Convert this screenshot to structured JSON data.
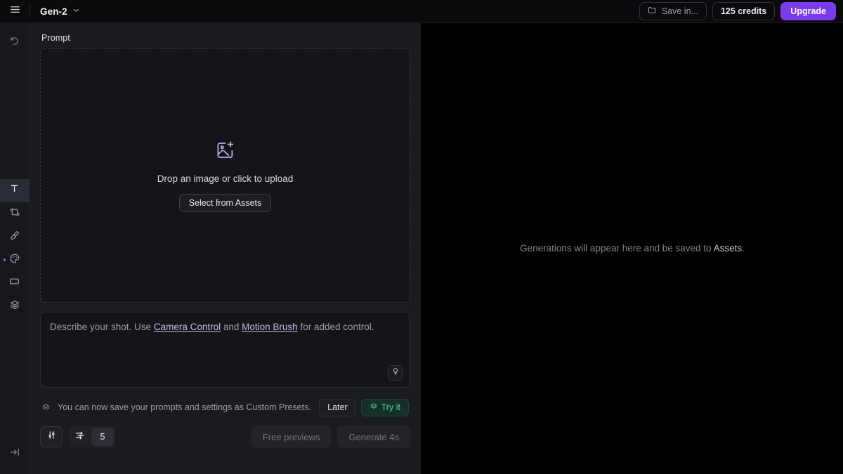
{
  "topbar": {
    "menu_icon": "hamburger-icon",
    "model_name": "Gen-2",
    "model_caret_icon": "chevron-down-icon",
    "save_in_label": "Save in...",
    "save_in_icon": "folder-icon",
    "credits_label": "125 credits",
    "upgrade_label": "Upgrade",
    "upgrade_color": "#7c3aed"
  },
  "rail": {
    "history_icon": "history-undo-icon",
    "tools": [
      {
        "name": "tool-text",
        "icon": "text-T-icon",
        "active": true
      },
      {
        "name": "tool-image-to-video",
        "icon": "image-rotate-icon",
        "active": false
      },
      {
        "name": "tool-motion-brush",
        "icon": "paint-brush-icon",
        "active": false
      },
      {
        "name": "tool-style",
        "icon": "color-palette-icon",
        "active": false,
        "badge": true
      },
      {
        "name": "tool-aspect-ratio",
        "icon": "rectangle-icon",
        "active": false
      },
      {
        "name": "tool-presets",
        "icon": "layers-icon",
        "active": false
      }
    ],
    "expand_icon": "arrow-to-line-right-icon"
  },
  "left": {
    "prompt_label": "Prompt",
    "dropzone": {
      "icon": "image-plus-icon",
      "icon_color": "#b9aee8",
      "text": "Drop an image or click to upload",
      "button_label": "Select from Assets"
    },
    "prompt_input": {
      "value": "",
      "placeholder_part1": "Describe your shot. Use ",
      "link1": "Camera Control",
      "placeholder_part2": " and ",
      "link2": "Motion Brush",
      "placeholder_part3": " for added control.",
      "hint_icon": "lightbulb-icon"
    },
    "notice": {
      "icon": "layers-icon",
      "text": "You can now save your prompts and settings as Custom Presets.",
      "later_label": "Later",
      "try_label": "Try it",
      "try_icon": "layers-icon",
      "try_color": "#4fd6a0"
    },
    "bottom": {
      "settings_icon": "sliders-settings-icon",
      "motion_icon": "motion-speed-icon",
      "motion_value": "5",
      "free_previews_label": "Free previews",
      "generate_label": "Generate 4s"
    }
  },
  "right": {
    "empty_text_part1": "Generations will appear here and be saved to ",
    "empty_link": "Assets",
    "empty_text_part2": "."
  }
}
